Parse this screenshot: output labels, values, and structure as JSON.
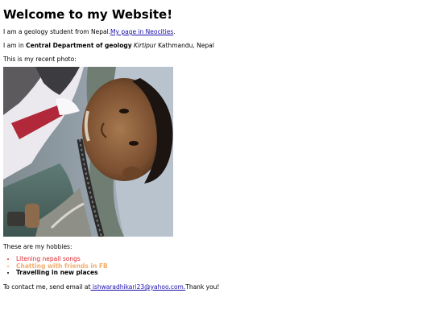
{
  "page": {
    "heading": "Welcome to my Website!",
    "intro_text": "I am a geology student from Nepal.",
    "neocities_link": "My page in Neocities",
    "intro_end": ".",
    "location_prefix": "I am in ",
    "department": "Central Department of geology",
    "campus": "Kirtipur",
    "city": " Kathmandu, Nepal",
    "photo_caption": "This is my recent photo:",
    "hobbies_intro": "These are my hobbies:",
    "hobbies": [
      {
        "label": "Litening nepali songs",
        "color": "#e0262d"
      },
      {
        "label": "Chatting with friends in FB",
        "color": "#f3ad6a"
      },
      {
        "label": "Travelling in new places",
        "color": "#000000"
      }
    ],
    "contact_prefix": "To contact me, send email at",
    "email": " ishwaradhikari23@yahoo.com.",
    "contact_suffix": "Thank you!"
  }
}
